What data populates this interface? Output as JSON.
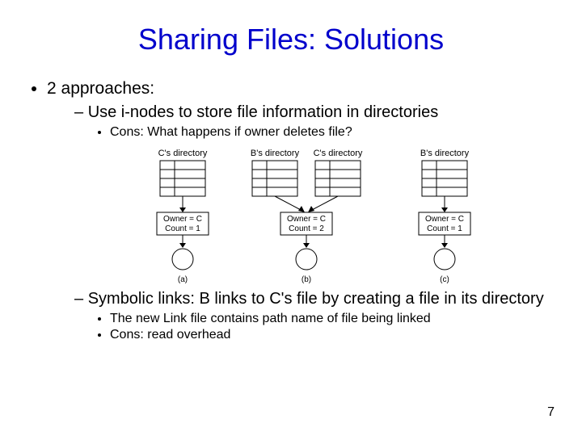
{
  "title": "Sharing Files: Solutions",
  "bullet1": "2 approaches:",
  "sub1": "Use i-nodes to store file information in directories",
  "sub1_cons": "Cons: What happens if owner deletes file?",
  "sub2": "Symbolic links: B links to C's file by creating a file in its directory",
  "sub2_a": "The new Link file contains path name of file being linked",
  "sub2_b": "Cons: read overhead",
  "page_number": "7",
  "figure": {
    "labels": {
      "c_dir": "C's directory",
      "b_dir": "B's directory",
      "owner_line": "Owner = C",
      "count1": "Count = 1",
      "count2": "Count = 2",
      "sub_a": "(a)",
      "sub_b": "(b)",
      "sub_c": "(c)"
    }
  }
}
